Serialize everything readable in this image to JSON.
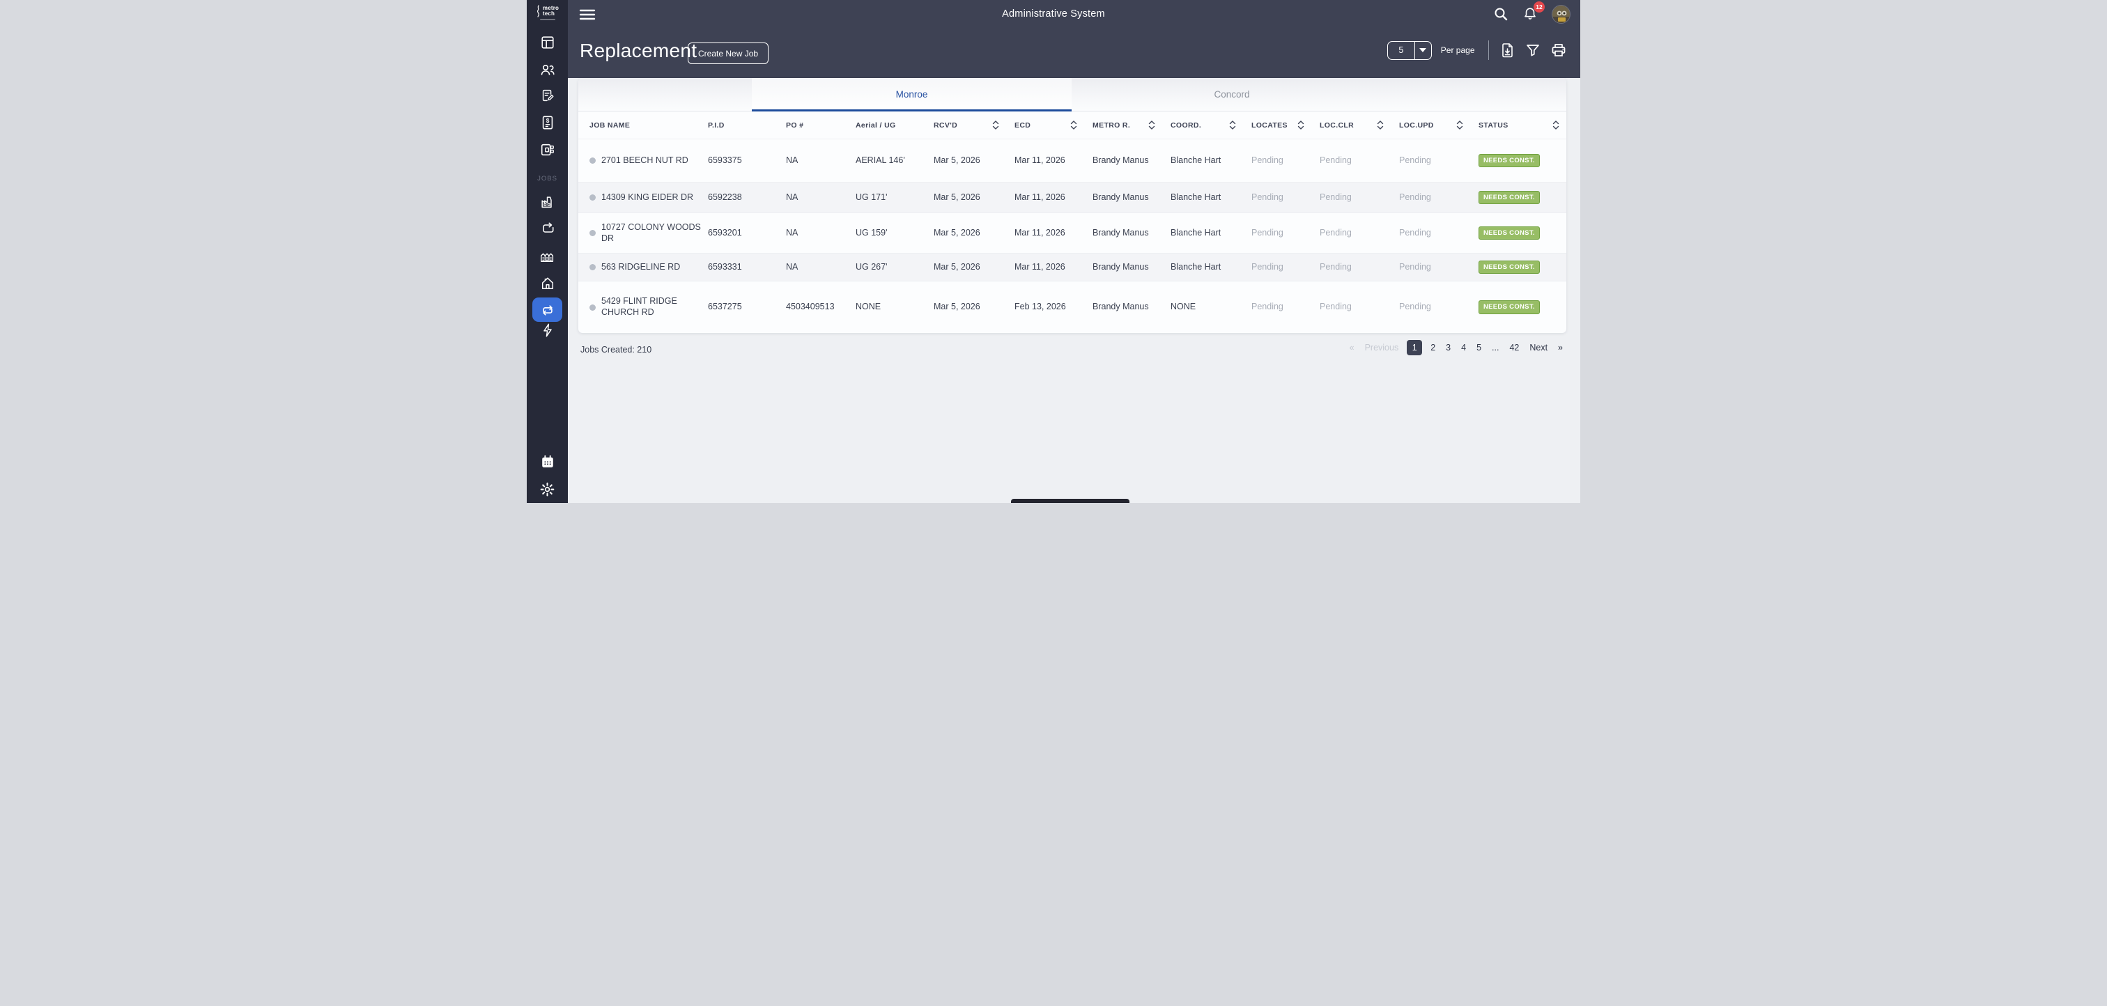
{
  "app": {
    "title": "Administrative System",
    "notification_count": "12"
  },
  "page": {
    "title": "Replacement",
    "create_job_button": "Create New Job",
    "per_page_value": "5",
    "per_page_label": "Per page"
  },
  "tabs": {
    "monroe": "Monroe",
    "concord": "Concord"
  },
  "sidebar": {
    "logo_line1": "metro",
    "logo_line2": "tech",
    "jobs_section_label": "JOBS"
  },
  "icons": {
    "header": [
      "menu-icon",
      "search-icon",
      "bell-icon",
      "avatar"
    ],
    "toolbar": [
      "export-file-icon",
      "filter-icon",
      "print-icon"
    ],
    "sidebar": [
      "dashboard-icon",
      "users-icon",
      "edit-document-icon",
      "invoice-icon",
      "cards-icon",
      "factory-icon",
      "redo-box-icon",
      "buildings-icon",
      "home-icon",
      "replacement-repeat-icon",
      "lightning-icon",
      "calendar-icon",
      "settings-gear-icon"
    ],
    "sort": "chevron-up-down",
    "per_page_caret": "triangle-down"
  },
  "table": {
    "columns": [
      {
        "label": "JOB NAME",
        "sortable": false
      },
      {
        "label": "P.I.D",
        "sortable": false
      },
      {
        "label": "PO #",
        "sortable": false
      },
      {
        "label": "Aerial / UG",
        "sortable": false
      },
      {
        "label": "RCV'D",
        "sortable": true
      },
      {
        "label": "ECD",
        "sortable": true
      },
      {
        "label": "METRO R.",
        "sortable": true
      },
      {
        "label": "COORD.",
        "sortable": true
      },
      {
        "label": "LOCATES",
        "sortable": true
      },
      {
        "label": "LOC.CLR",
        "sortable": true
      },
      {
        "label": "LOC.UPD",
        "sortable": true
      },
      {
        "label": "STATUS",
        "sortable": true
      }
    ],
    "rows": [
      {
        "cells": [
          "2701 BEECH NUT RD",
          "6593375",
          "NA",
          "AERIAL 146'",
          "Mar 5, 2026",
          "Mar 11, 2026",
          "Brandy Manus",
          "Blanche Hart",
          "Pending",
          "Pending",
          "Pending"
        ],
        "status": "NEEDS CONST."
      },
      {
        "cells": [
          "14309 KING EIDER DR",
          "6592238",
          "NA",
          "UG 171'",
          "Mar 5, 2026",
          "Mar 11, 2026",
          "Brandy Manus",
          "Blanche Hart",
          "Pending",
          "Pending",
          "Pending"
        ],
        "status": "NEEDS CONST."
      },
      {
        "cells": [
          "10727 COLONY WOODS DR",
          "6593201",
          "NA",
          "UG 159'",
          "Mar 5, 2026",
          "Mar 11, 2026",
          "Brandy Manus",
          "Blanche Hart",
          "Pending",
          "Pending",
          "Pending"
        ],
        "status": "NEEDS CONST."
      },
      {
        "cells": [
          "563 RIDGELINE RD",
          "6593331",
          "NA",
          "UG 267'",
          "Mar 5, 2026",
          "Mar 11, 2026",
          "Brandy Manus",
          "Blanche Hart",
          "Pending",
          "Pending",
          "Pending"
        ],
        "status": "NEEDS CONST."
      },
      {
        "cells": [
          "5429 FLINT RIDGE CHURCH RD",
          "6537275",
          "4503409513",
          "NONE",
          "Mar 5, 2026",
          "Feb 13, 2026",
          "Brandy Manus",
          "NONE",
          "Pending",
          "Pending",
          "Pending"
        ],
        "status": "NEEDS CONST."
      }
    ]
  },
  "footer": {
    "jobs_created": "Jobs Created: 210"
  },
  "pagination": {
    "prev_symbol": "«",
    "prev_label": "Previous",
    "pages": [
      "1",
      "2",
      "3",
      "4",
      "5",
      "...",
      "42"
    ],
    "active_page": "1",
    "next_label": "Next",
    "next_symbol": "»"
  },
  "colors": {
    "header_dark": "#3e4254",
    "sidebar_dark": "#262938",
    "accent_blue": "#3a6fd8",
    "tab_blue": "#1d4c9c",
    "badge_green": "#97bd65",
    "badge_border": "#70a13f",
    "notification_red": "#e5484d"
  }
}
